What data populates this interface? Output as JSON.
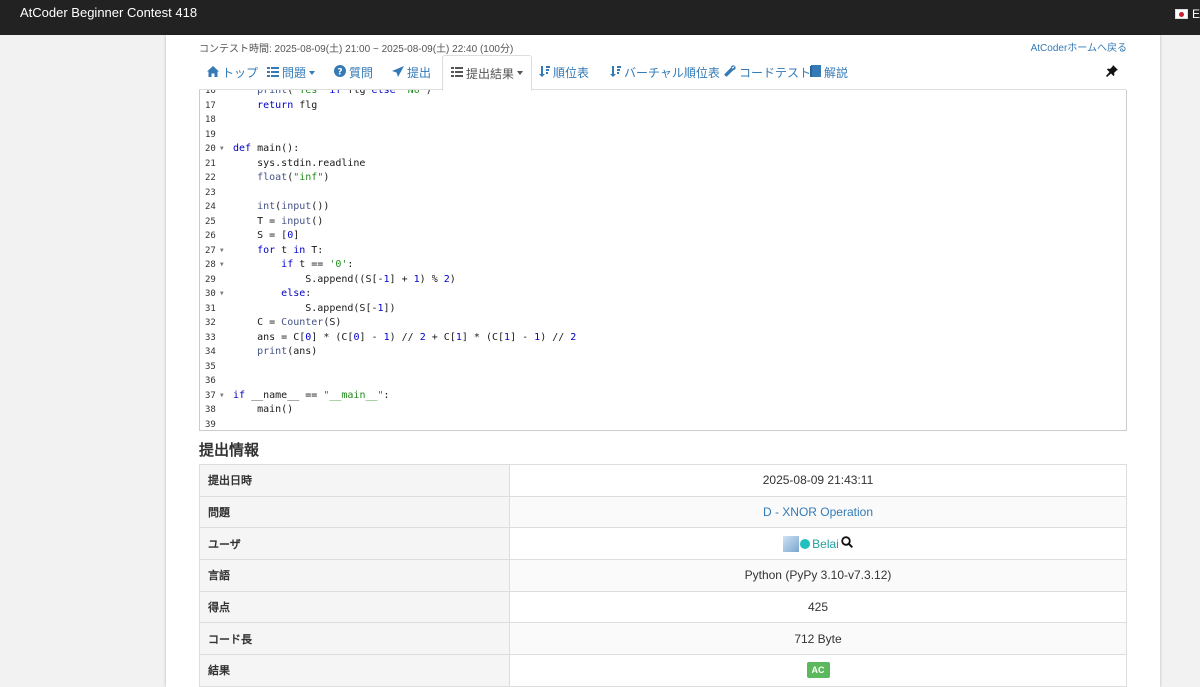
{
  "topbar": {
    "brand": "AtCoder Beginner Contest 418",
    "lang_text": "E"
  },
  "contest": {
    "time_text": "コンテスト時間: 2025-08-09(土) 21:00 ~ 2025-08-09(土) 22:40 (100分)",
    "home_link": "AtCoderホームへ戻る"
  },
  "nav": {
    "tabs": [
      {
        "icon": "home-icon",
        "label": "トップ"
      },
      {
        "icon": "list-icon",
        "label": "問題"
      },
      {
        "icon": "question-icon",
        "label": "質問"
      },
      {
        "icon": "send-icon",
        "label": "提出"
      },
      {
        "icon": "table-list-icon",
        "label": "提出結果"
      },
      {
        "icon": "sort-icon",
        "label": "順位表"
      },
      {
        "icon": "sort-icon",
        "label": "バーチャル順位表"
      },
      {
        "icon": "wrench-icon",
        "label": "コードテスト"
      },
      {
        "icon": "book-icon",
        "label": "解説"
      }
    ]
  },
  "code": {
    "lines": [
      {
        "n": "16",
        "fold": false,
        "text": "    print('Yes' if flg else 'No')"
      },
      {
        "n": "17",
        "fold": false,
        "text": "    return flg"
      },
      {
        "n": "18",
        "fold": false,
        "text": ""
      },
      {
        "n": "19",
        "fold": false,
        "text": ""
      },
      {
        "n": "20",
        "fold": true,
        "text": "def main():"
      },
      {
        "n": "21",
        "fold": false,
        "text": "    sys.stdin.readline"
      },
      {
        "n": "22",
        "fold": false,
        "text": "    float(\"inf\")"
      },
      {
        "n": "23",
        "fold": false,
        "text": ""
      },
      {
        "n": "24",
        "fold": false,
        "text": "    int(input())"
      },
      {
        "n": "25",
        "fold": false,
        "text": "    T = input()"
      },
      {
        "n": "26",
        "fold": false,
        "text": "    S = [0]"
      },
      {
        "n": "27",
        "fold": true,
        "text": "    for t in T:"
      },
      {
        "n": "28",
        "fold": true,
        "text": "        if t == '0':"
      },
      {
        "n": "29",
        "fold": false,
        "text": "            S.append((S[-1] + 1) % 2)"
      },
      {
        "n": "30",
        "fold": true,
        "text": "        else:"
      },
      {
        "n": "31",
        "fold": false,
        "text": "            S.append(S[-1])"
      },
      {
        "n": "32",
        "fold": false,
        "text": "    C = Counter(S)"
      },
      {
        "n": "33",
        "fold": false,
        "text": "    ans = C[0] * (C[0] - 1) // 2 + C[1] * (C[1] - 1) // 2"
      },
      {
        "n": "34",
        "fold": false,
        "text": "    print(ans)"
      },
      {
        "n": "35",
        "fold": false,
        "text": ""
      },
      {
        "n": "36",
        "fold": false,
        "text": ""
      },
      {
        "n": "37",
        "fold": true,
        "text": "if __name__ == \"__main__\":"
      },
      {
        "n": "38",
        "fold": false,
        "text": "    main()"
      },
      {
        "n": "39",
        "fold": false,
        "text": ""
      }
    ]
  },
  "info": {
    "title": "提出情報",
    "rows": [
      {
        "key": "提出日時",
        "value": "2025-08-09 21:43:11"
      },
      {
        "key": "問題",
        "value": "D - XNOR Operation"
      },
      {
        "key": "ユーザ",
        "value": "Belai"
      },
      {
        "key": "言語",
        "value": "Python (PyPy 3.10-v7.3.12)"
      },
      {
        "key": "得点",
        "value": "425"
      },
      {
        "key": "コード長",
        "value": "712 Byte"
      },
      {
        "key": "結果",
        "value": "AC"
      }
    ]
  },
  "colors": {
    "link": "#337ab7",
    "ac_badge": "#5cb85c",
    "user": "#20a0a0"
  }
}
